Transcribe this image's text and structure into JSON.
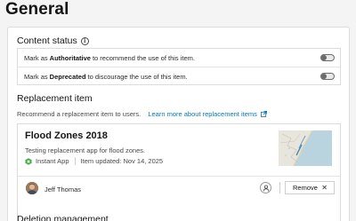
{
  "page": {
    "title": "General"
  },
  "content_status": {
    "heading": "Content status",
    "info_icon": "info-icon",
    "rows": [
      {
        "prefix": "Mark as",
        "emphasis": "Authoritative",
        "suffix": "to recommend the use of this item.",
        "toggle_on": false
      },
      {
        "prefix": "Mark as",
        "emphasis": "Deprecated",
        "suffix": "to discourage the use of this item.",
        "toggle_on": false
      }
    ]
  },
  "replacement": {
    "heading": "Replacement item",
    "description": "Recommend a replacement item to users.",
    "link_text": "Learn more about replacement items",
    "link_icon": "external-link-icon",
    "item": {
      "title": "Flood Zones 2018",
      "description": "Testing replacement app for flood zones.",
      "type_label": "Instant App",
      "updated_label": "Item updated: Nov 14, 2025",
      "owner_name": "Jeff Thomas",
      "remove_label": "Remove",
      "remove_icon": "close-icon",
      "owner_icon": "user-icon"
    }
  },
  "next_section": {
    "heading": "Deletion management"
  },
  "colors": {
    "link": "#007ac2",
    "app_icon": "#35ac46",
    "background": "#f4f4f4"
  }
}
